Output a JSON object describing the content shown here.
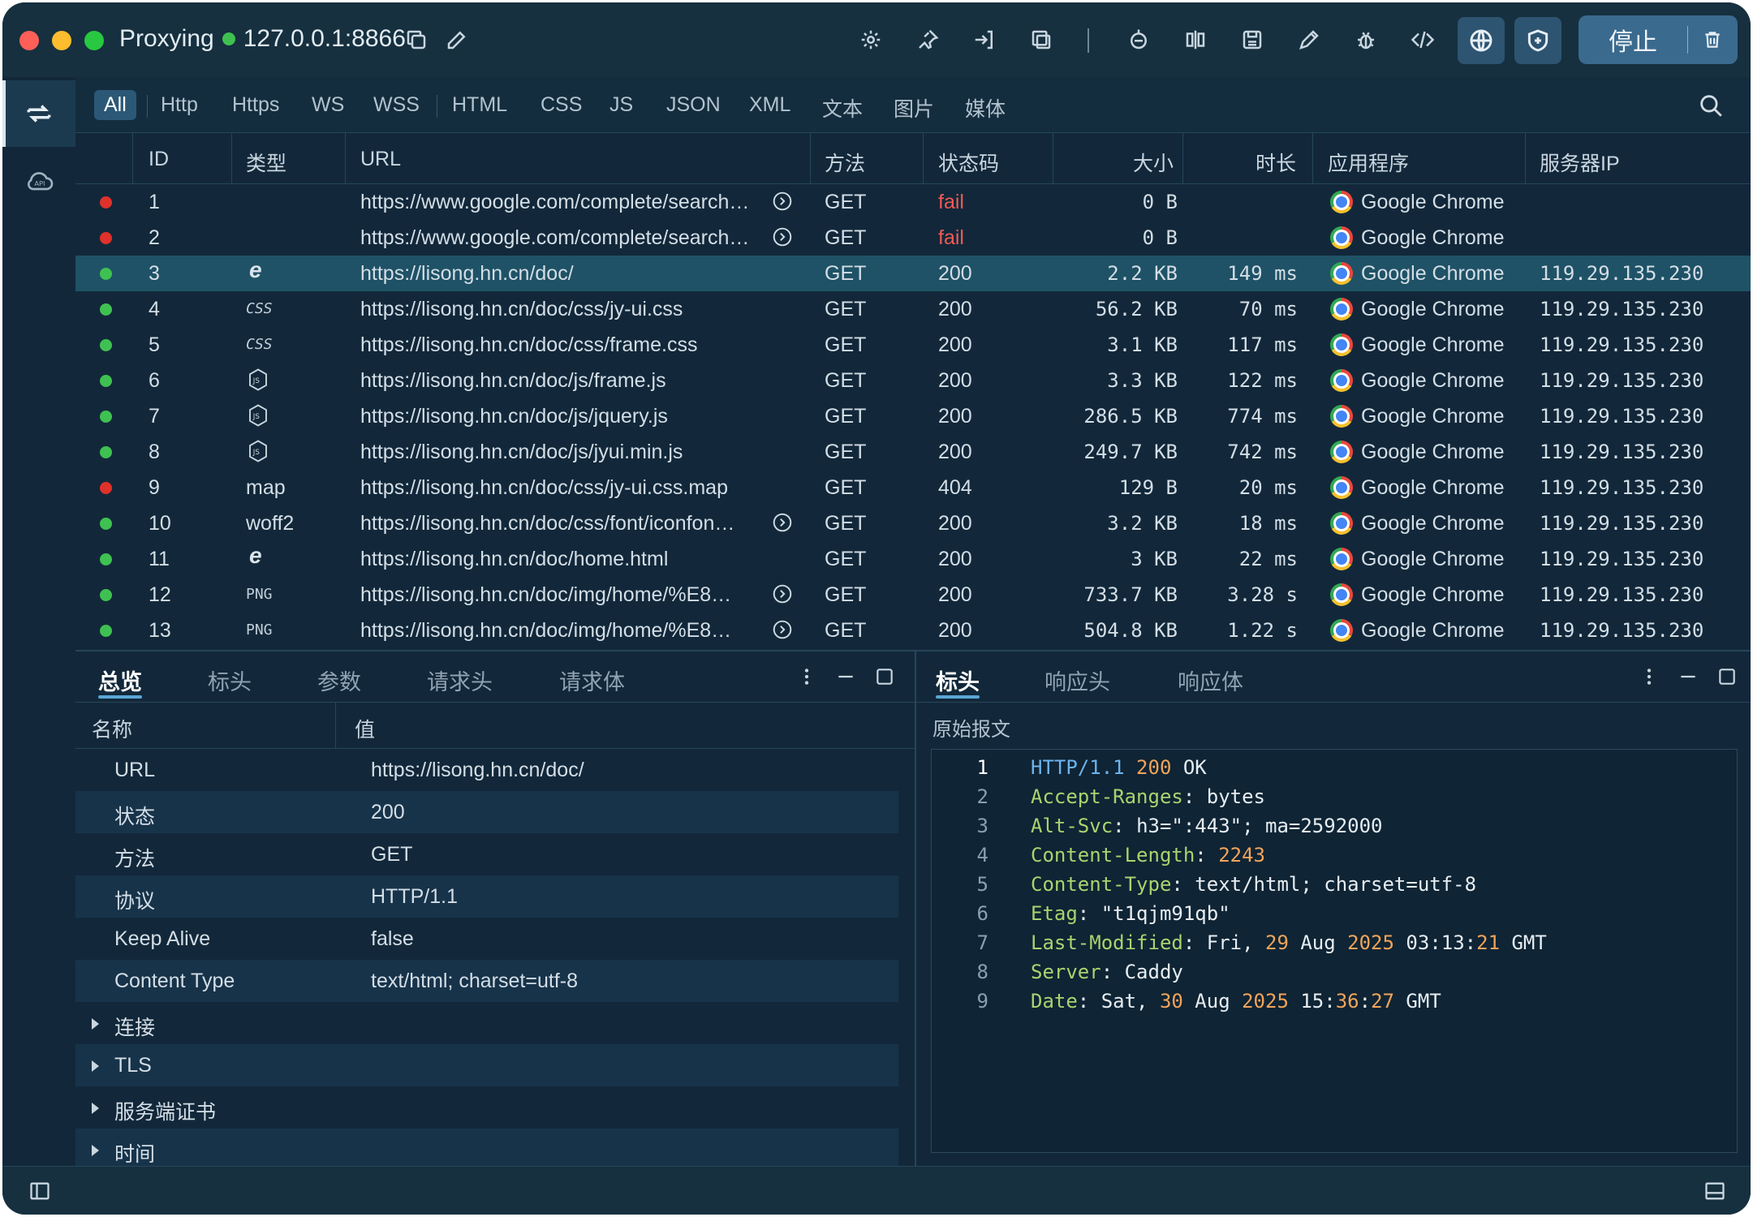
{
  "window": {
    "app_name": "Proxying",
    "address": "127.0.0.1:8866",
    "stop_label": "停止"
  },
  "filters": [
    "All",
    "Http",
    "Https",
    "WS",
    "WSS",
    "HTML",
    "CSS",
    "JS",
    "JSON",
    "XML",
    "文本",
    "图片",
    "媒体"
  ],
  "table": {
    "columns": [
      "ID",
      "类型",
      "URL",
      "方法",
      "状态码",
      "大小",
      "时长",
      "应用程序",
      "服务器IP"
    ],
    "rows": [
      {
        "status": "red",
        "id": "1",
        "type": "",
        "url": "https://www.google.com/complete/search…",
        "method": "GET",
        "code": "fail",
        "size": "0 B",
        "time": "",
        "app": "Google Chrome",
        "ip": "",
        "link": true
      },
      {
        "status": "red",
        "id": "2",
        "type": "",
        "url": "https://www.google.com/complete/search…",
        "method": "GET",
        "code": "fail",
        "size": "0 B",
        "time": "",
        "app": "Google Chrome",
        "ip": "",
        "link": true
      },
      {
        "status": "green",
        "id": "3",
        "type": "ie-icon",
        "url": "https://lisong.hn.cn/doc/",
        "method": "GET",
        "code": "200",
        "size": "2.2 KB",
        "time": "149 ms",
        "app": "Google Chrome",
        "ip": "119.29.135.230",
        "selected": true
      },
      {
        "status": "green",
        "id": "4",
        "type": "CSS",
        "url": "https://lisong.hn.cn/doc/css/jy-ui.css",
        "method": "GET",
        "code": "200",
        "size": "56.2 KB",
        "time": "70 ms",
        "app": "Google Chrome",
        "ip": "119.29.135.230"
      },
      {
        "status": "green",
        "id": "5",
        "type": "CSS",
        "url": "https://lisong.hn.cn/doc/css/frame.css",
        "method": "GET",
        "code": "200",
        "size": "3.1 KB",
        "time": "117 ms",
        "app": "Google Chrome",
        "ip": "119.29.135.230"
      },
      {
        "status": "green",
        "id": "6",
        "type": "js-icon",
        "url": "https://lisong.hn.cn/doc/js/frame.js",
        "method": "GET",
        "code": "200",
        "size": "3.3 KB",
        "time": "122 ms",
        "app": "Google Chrome",
        "ip": "119.29.135.230"
      },
      {
        "status": "green",
        "id": "7",
        "type": "js-icon",
        "url": "https://lisong.hn.cn/doc/js/jquery.js",
        "method": "GET",
        "code": "200",
        "size": "286.5 KB",
        "time": "774 ms",
        "app": "Google Chrome",
        "ip": "119.29.135.230"
      },
      {
        "status": "green",
        "id": "8",
        "type": "js-icon",
        "url": "https://lisong.hn.cn/doc/js/jyui.min.js",
        "method": "GET",
        "code": "200",
        "size": "249.7 KB",
        "time": "742 ms",
        "app": "Google Chrome",
        "ip": "119.29.135.230"
      },
      {
        "status": "red",
        "id": "9",
        "type": "map",
        "url": "https://lisong.hn.cn/doc/css/jy-ui.css.map",
        "method": "GET",
        "code": "404",
        "size": "129 B",
        "time": "20 ms",
        "app": "Google Chrome",
        "ip": "119.29.135.230"
      },
      {
        "status": "green",
        "id": "10",
        "type": "woff2",
        "url": "https://lisong.hn.cn/doc/css/font/iconfon…",
        "method": "GET",
        "code": "200",
        "size": "3.2 KB",
        "time": "18 ms",
        "app": "Google Chrome",
        "ip": "119.29.135.230",
        "link": true
      },
      {
        "status": "green",
        "id": "11",
        "type": "ie-icon",
        "url": "https://lisong.hn.cn/doc/home.html",
        "method": "GET",
        "code": "200",
        "size": "3 KB",
        "time": "22 ms",
        "app": "Google Chrome",
        "ip": "119.29.135.230"
      },
      {
        "status": "green",
        "id": "12",
        "type": "PNG",
        "url": "https://lisong.hn.cn/doc/img/home/%E8…",
        "method": "GET",
        "code": "200",
        "size": "733.7 KB",
        "time": "3.28 s",
        "app": "Google Chrome",
        "ip": "119.29.135.230",
        "link": true
      },
      {
        "status": "green",
        "id": "13",
        "type": "PNG",
        "url": "https://lisong.hn.cn/doc/img/home/%E8…",
        "method": "GET",
        "code": "200",
        "size": "504.8 KB",
        "time": "1.22 s",
        "app": "Google Chrome",
        "ip": "119.29.135.230",
        "link": true
      }
    ]
  },
  "overview": {
    "tabs": [
      "总览",
      "标头",
      "参数",
      "请求头",
      "请求体"
    ],
    "head_name": "名称",
    "head_value": "值",
    "rows": [
      {
        "k": "URL",
        "v": "https://lisong.hn.cn/doc/"
      },
      {
        "k": "状态",
        "v": "200"
      },
      {
        "k": "方法",
        "v": "GET"
      },
      {
        "k": "协议",
        "v": "HTTP/1.1"
      },
      {
        "k": "Keep Alive",
        "v": "false"
      },
      {
        "k": "Content Type",
        "v": "text/html; charset=utf-8"
      }
    ],
    "sections": [
      "连接",
      "TLS",
      "服务端证书",
      "时间"
    ]
  },
  "response": {
    "tabs": [
      "标头",
      "响应头",
      "响应体"
    ],
    "raw_label": "原始报文",
    "lines": [
      {
        "n": "1",
        "k": "HTTP/1.1",
        "sep": " ",
        "v": "200 OK"
      },
      {
        "n": "2",
        "k": "Accept-Ranges",
        "sep": ": ",
        "v": "bytes"
      },
      {
        "n": "3",
        "k": "Alt-Svc",
        "sep": ": ",
        "v": "h3=\":443\"; ma=2592000"
      },
      {
        "n": "4",
        "k": "Content-Length",
        "sep": ": ",
        "v": "2243"
      },
      {
        "n": "5",
        "k": "Content-Type",
        "sep": ": ",
        "v": "text/html; charset=utf-8"
      },
      {
        "n": "6",
        "k": "Etag",
        "sep": ": ",
        "v": "\"t1qjm91qb\""
      },
      {
        "n": "7",
        "k": "Last-Modified",
        "sep": ": ",
        "v": "Fri, 29 Aug 2025 03:13:21 GMT"
      },
      {
        "n": "8",
        "k": "Server",
        "sep": ": ",
        "v": "Caddy"
      },
      {
        "n": "9",
        "k": "Date",
        "sep": ": ",
        "v": "Sat, 30 Aug 2025 15:36:27 GMT"
      }
    ]
  },
  "colors": {
    "accent": "#2b5876",
    "selected_row": "#1f5266",
    "green": "#3fc152",
    "red": "#e0312b",
    "fail_text": "#f05a55",
    "header_key": "#a8d46f",
    "header_number": "#f0a45b"
  }
}
